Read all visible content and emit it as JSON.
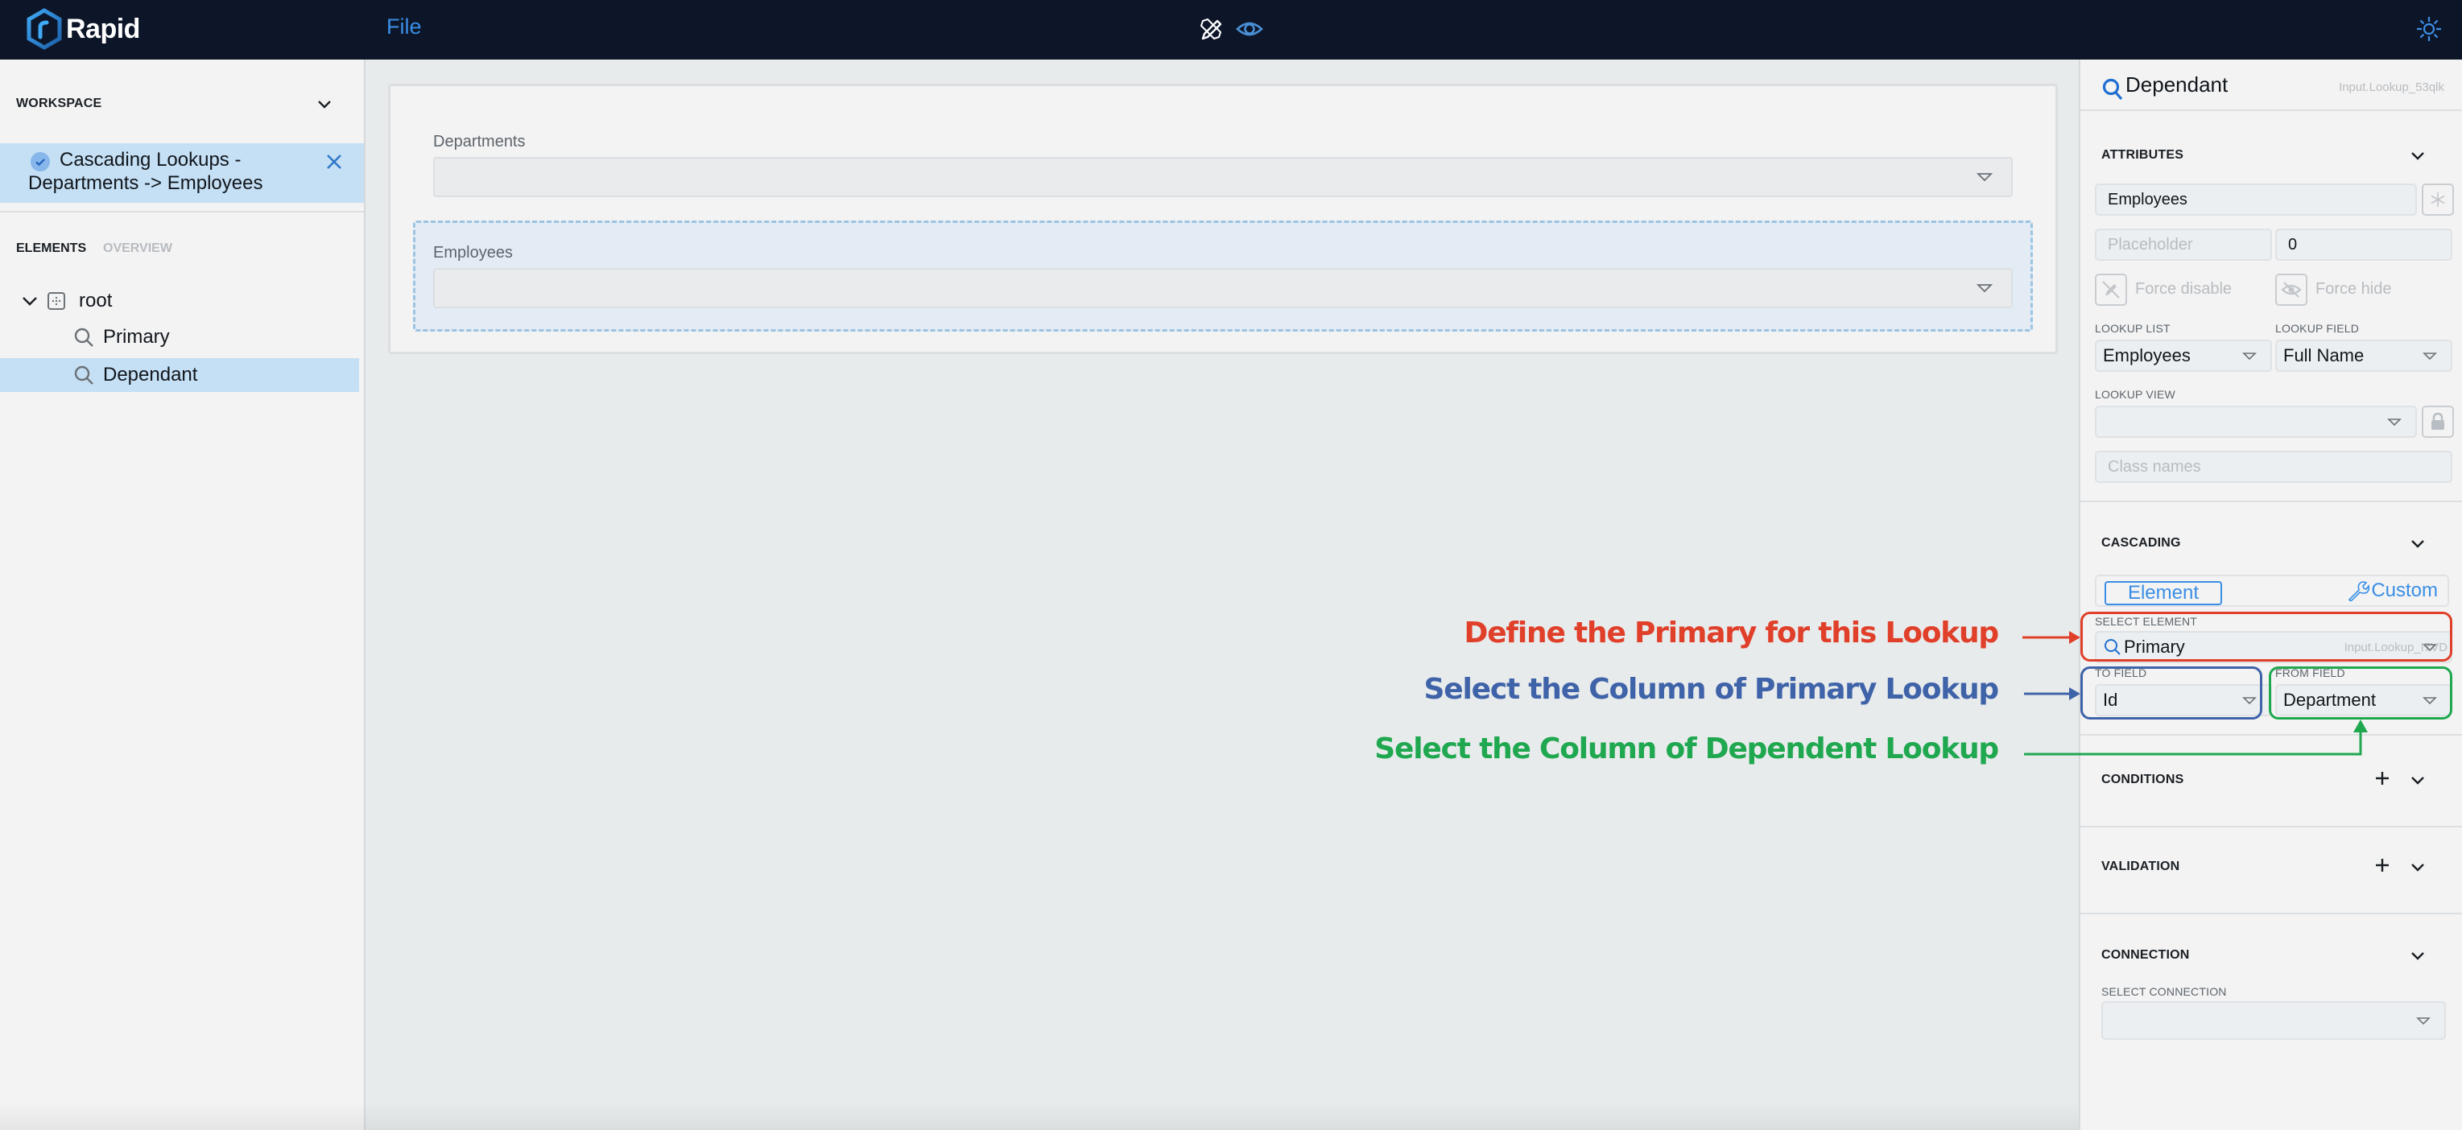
{
  "app": {
    "brand": "Rapid",
    "menu_file": "File",
    "icons": {
      "design": "pencil-ruler-icon",
      "preview": "eye-icon",
      "theme": "sun-icon"
    }
  },
  "sidebar": {
    "workspace_header": "WORKSPACE",
    "workspace_item": "Cascading Lookups - Departments -> Employees",
    "tabs": [
      {
        "label": "ELEMENTS",
        "active": true
      },
      {
        "label": "OVERVIEW",
        "active": false
      }
    ],
    "tree": [
      {
        "label": "root",
        "icon": "container-icon",
        "level": 0,
        "expanded": true
      },
      {
        "label": "Primary",
        "icon": "search-icon",
        "level": 1
      },
      {
        "label": "Dependant",
        "icon": "search-icon",
        "level": 1,
        "selected": true
      }
    ]
  },
  "canvas": {
    "fields": [
      {
        "label": "Departments",
        "value": ""
      },
      {
        "label": "Employees",
        "value": "",
        "selected": true
      }
    ]
  },
  "properties": {
    "title": "Dependant",
    "element_id": "Input.Lookup_53qlk",
    "sections": {
      "attributes": "ATTRIBUTES",
      "cascading": "CASCADING",
      "conditions": "CONDITIONS",
      "validation": "VALIDATION",
      "connection": "CONNECTION"
    },
    "attributes": {
      "label_value": "Employees",
      "placeholder_placeholder": "Placeholder",
      "default_value": "0",
      "force_disable": "Force disable",
      "force_hide": "Force hide",
      "lookup_list_label": "LOOKUP LIST",
      "lookup_list_value": "Employees",
      "lookup_field_label": "LOOKUP FIELD",
      "lookup_field_value": "Full Name",
      "lookup_view_label": "LOOKUP VIEW",
      "lookup_view_value": "",
      "class_names_placeholder": "Class names"
    },
    "cascading": {
      "mode_element": "Element",
      "mode_custom": "Custom",
      "select_element_label": "SELECT ELEMENT",
      "select_element_value": "Primary",
      "select_element_id": "Input.Lookup_I7VD",
      "to_field_label": "TO FIELD",
      "to_field_value": "Id",
      "from_field_label": "FROM FIELD",
      "from_field_value": "Department"
    },
    "connection": {
      "select_label": "SELECT CONNECTION",
      "select_value": ""
    }
  },
  "annotations": [
    {
      "text": "Define the Primary for this Lookup",
      "color": "#e0402a"
    },
    {
      "text": "Select the Column of Primary Lookup",
      "color": "#3f63a8"
    },
    {
      "text": "Select the Column of Dependent Lookup",
      "color": "#1fa84f"
    }
  ],
  "colors": {
    "accent": "#3a8ee6",
    "topbar": "#0d1628",
    "selection": "#c5dff4"
  }
}
